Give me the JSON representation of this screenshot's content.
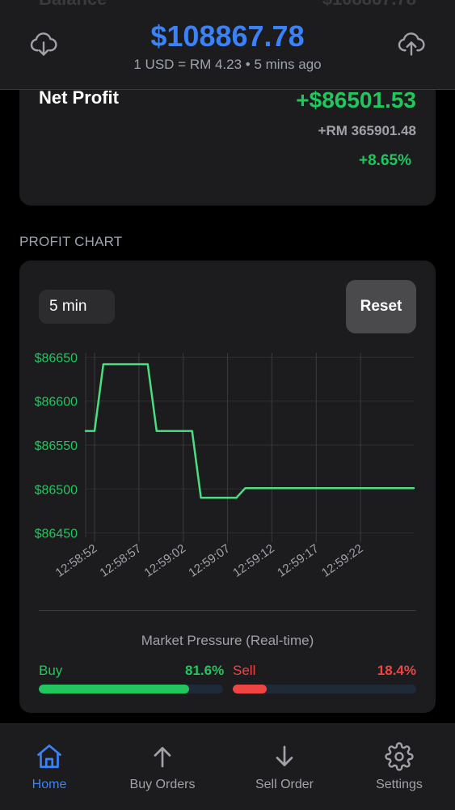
{
  "header": {
    "ghost_left": "Balance",
    "ghost_right": "$108867.78",
    "balance": "$108867.78",
    "rate_line": "1 USD = RM 4.23 • 5 mins ago",
    "left_icon": "cloud-download-icon",
    "right_icon": "cloud-upload-icon"
  },
  "net_profit": {
    "label": "Net Profit",
    "usd": "+$86501.53",
    "rm": "+RM 365901.48",
    "percent": "+8.65%"
  },
  "section_title": "PROFIT CHART",
  "controls": {
    "timeframe": "5 min",
    "reset": "Reset"
  },
  "chart_data": {
    "type": "line",
    "series": [
      {
        "x": [
          "12:58:51",
          "12:58:52",
          "12:58:53",
          "12:58:54",
          "12:58:58",
          "12:58:59",
          "12:59:00",
          "12:59:03",
          "12:59:04",
          "12:59:05",
          "12:59:06",
          "12:59:08",
          "12:59:09",
          "12:59:10",
          "12:59:28"
        ],
        "y": [
          86566,
          86566,
          86642,
          86642,
          86642,
          86566,
          86566,
          86566,
          86490,
          86490,
          86490,
          86490,
          86501,
          86501,
          86501
        ],
        "color": "#4ade80"
      }
    ],
    "y_ticks": [
      "$86650",
      "$86600",
      "$86550",
      "$86500",
      "$86450"
    ],
    "y_tick_values": [
      86650,
      86600,
      86550,
      86500,
      86450
    ],
    "x_ticks": [
      "12:58:52",
      "12:58:57",
      "12:59:02",
      "12:59:07",
      "12:59:12",
      "12:59:17",
      "12:59:22"
    ],
    "ylim": [
      86445,
      86655
    ],
    "xlim": [
      "12:58:51",
      "12:59:28"
    ],
    "grid": true,
    "line_color": "#4ade80",
    "tick_label_color_y": "#22c55e",
    "tick_label_color_x": "#a1a1aa"
  },
  "market_pressure": {
    "title": "Market Pressure (Real-time)",
    "buy_label": "Buy",
    "buy_percent": "81.6%",
    "buy_value": 81.6,
    "sell_label": "Sell",
    "sell_percent": "18.4%",
    "sell_value": 18.4
  },
  "nav": [
    {
      "label": "Home",
      "icon": "home-icon",
      "active": true
    },
    {
      "label": "Buy Orders",
      "icon": "arrow-up-icon",
      "active": false
    },
    {
      "label": "Sell Order",
      "icon": "arrow-down-icon",
      "active": false
    },
    {
      "label": "Settings",
      "icon": "gear-icon",
      "active": false
    }
  ],
  "colors": {
    "accent": "#3b82f6",
    "profit": "#22c55e",
    "loss": "#ef4444"
  }
}
